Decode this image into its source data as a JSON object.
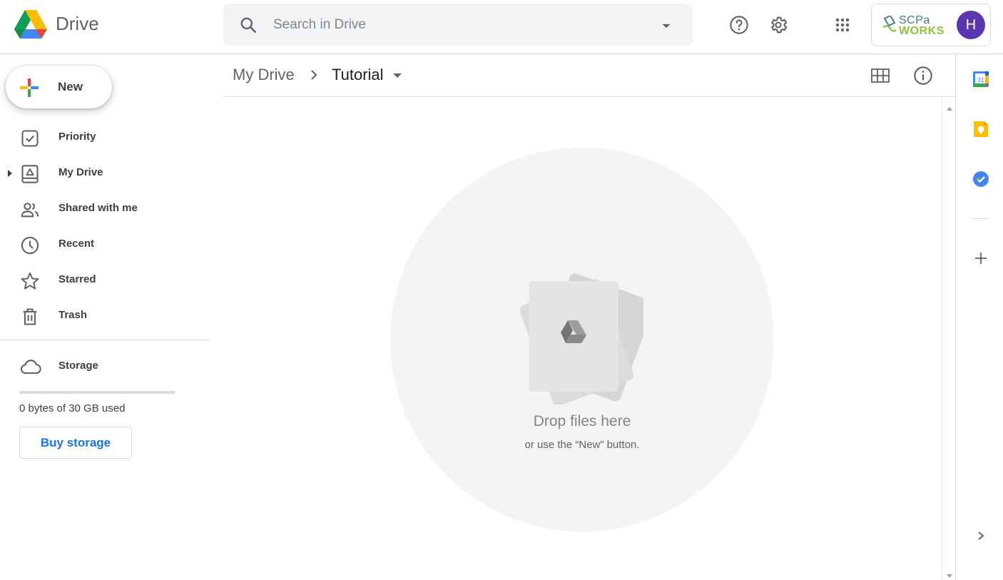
{
  "header": {
    "app_name": "Drive",
    "search_placeholder": "Search in Drive",
    "org_line1": "SCPa",
    "org_line2": "WORKS",
    "avatar_initial": "H",
    "avatar_color": "#5e35b1"
  },
  "sidebar": {
    "new_label": "New",
    "items": [
      {
        "label": "Priority",
        "icon": "priority-icon"
      },
      {
        "label": "My Drive",
        "icon": "my-drive-icon"
      },
      {
        "label": "Shared with me",
        "icon": "shared-icon"
      },
      {
        "label": "Recent",
        "icon": "clock-icon"
      },
      {
        "label": "Starred",
        "icon": "star-icon"
      },
      {
        "label": "Trash",
        "icon": "trash-icon"
      }
    ],
    "storage_label": "Storage",
    "storage_used_text": "0 bytes of 30 GB used",
    "storage_used_fraction": 0,
    "buy_storage_label": "Buy storage"
  },
  "main": {
    "breadcrumb_root": "My Drive",
    "breadcrumb_current": "Tutorial",
    "empty_title": "Drop files here",
    "empty_subtitle": "or use the “New” button."
  },
  "side_panel": {
    "apps": [
      "calendar-icon",
      "keep-icon",
      "tasks-icon",
      "add-icon"
    ],
    "calendar_day": "31"
  },
  "colors": {
    "accent": "#1a73e8",
    "google_blue": "#4285f4",
    "google_red": "#ea4335",
    "google_yellow": "#fbbc04",
    "google_green": "#34a853"
  }
}
